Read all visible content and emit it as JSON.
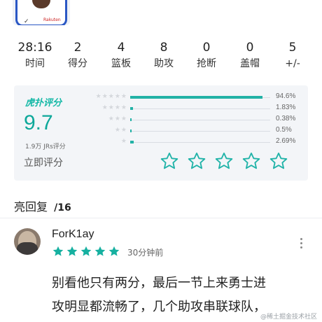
{
  "player_image": {
    "icon": "player-jersey-image",
    "brand_text": "Rakuten"
  },
  "stats": [
    {
      "value": "28:16",
      "label": "时间"
    },
    {
      "value": "2",
      "label": "得分"
    },
    {
      "value": "4",
      "label": "篮板"
    },
    {
      "value": "8",
      "label": "助攻"
    },
    {
      "value": "0",
      "label": "抢断"
    },
    {
      "value": "0",
      "label": "盖帽"
    },
    {
      "value": "5",
      "label": "+/-"
    }
  ],
  "rating": {
    "logo_text": "虎扑评分",
    "score": "9.7",
    "count_text": "1.9万 JRs评分",
    "action_label": "立即评分",
    "accent_color": "#14b8a6",
    "distribution": [
      {
        "stars": 5,
        "percent_label": "94.6%",
        "fraction": 0.946
      },
      {
        "stars": 4,
        "percent_label": "1.83%",
        "fraction": 0.0183
      },
      {
        "stars": 3,
        "percent_label": "0.38%",
        "fraction": 0.0038
      },
      {
        "stars": 2,
        "percent_label": "0.5%",
        "fraction": 0.005
      },
      {
        "stars": 1,
        "percent_label": "2.69%",
        "fraction": 0.0269
      }
    ],
    "input_stars_count": 5,
    "input_star_icon": "star-outline-icon"
  },
  "replies": {
    "title": "亮回复",
    "count": "/16"
  },
  "comment": {
    "username": "ForK1ay",
    "user_rating": 5,
    "star_color": "#16b0a0",
    "time": "30分钟前",
    "text_line1": "别看他只有两分，最后一节上来勇士进",
    "text_line2": "攻明显都流畅了，几个助攻串联球队，"
  },
  "watermark": "@稀土掘金技术社区"
}
